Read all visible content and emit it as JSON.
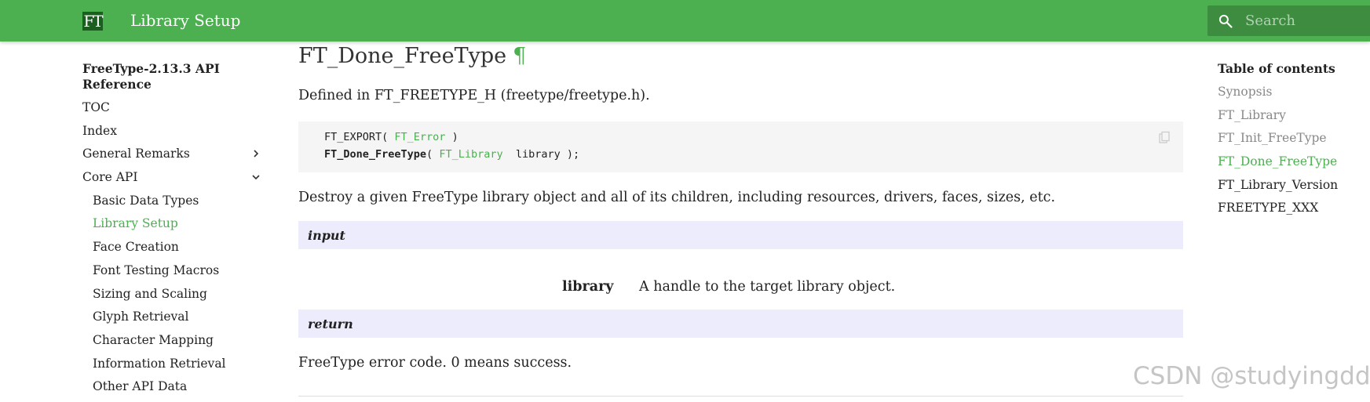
{
  "header": {
    "logo_text": "FT",
    "title": "Library Setup",
    "search_placeholder": "Search",
    "color": "#4caf50"
  },
  "sidebar": {
    "heading": "FreeType-2.13.3 API Reference",
    "items": [
      {
        "label": "TOC"
      },
      {
        "label": "Index"
      },
      {
        "label": "General Remarks",
        "chevron": "right"
      },
      {
        "label": "Core API",
        "chevron": "down"
      }
    ],
    "subitems": [
      {
        "label": "Basic Data Types"
      },
      {
        "label": "Library Setup",
        "active": true
      },
      {
        "label": "Face Creation"
      },
      {
        "label": "Font Testing Macros"
      },
      {
        "label": "Sizing and Scaling"
      },
      {
        "label": "Glyph Retrieval"
      },
      {
        "label": "Character Mapping"
      },
      {
        "label": "Information Retrieval"
      },
      {
        "label": "Other API Data"
      }
    ]
  },
  "main": {
    "title": "FT_Done_FreeType",
    "anchor": "¶",
    "defined_in": "Defined in FT_FREETYPE_H (freetype/freetype.h).",
    "code": {
      "line1_prefix": "FT_EXPORT( ",
      "line1_type": "FT_Error",
      "line1_suffix": " )",
      "line2_func": "FT_Done_FreeType",
      "line2_mid": "( ",
      "line2_type": "FT_Library",
      "line2_suffix": "  library );"
    },
    "description": "Destroy a given FreeType library object and all of its children, including resources, drivers, faces, sizes, etc.",
    "input_label": "input",
    "param_name": "library",
    "param_desc": "A handle to the target library object.",
    "return_label": "return",
    "return_text": "FreeType error code. 0 means success."
  },
  "toc": {
    "title": "Table of contents",
    "items": [
      {
        "label": "Synopsis",
        "state": "muted"
      },
      {
        "label": "FT_Library",
        "state": "muted"
      },
      {
        "label": "FT_Init_FreeType",
        "state": "muted"
      },
      {
        "label": "FT_Done_FreeType",
        "state": "active"
      },
      {
        "label": "FT_Library_Version",
        "state": "dark"
      },
      {
        "label": "FREETYPE_XXX",
        "state": "dark"
      }
    ]
  },
  "watermark": "CSDN @studyingdda"
}
